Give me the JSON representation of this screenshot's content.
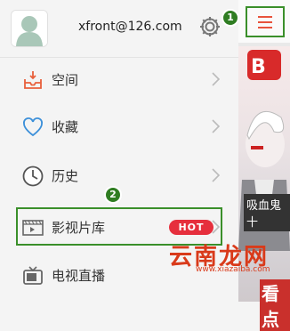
{
  "header": {
    "email": "xfront@126.com"
  },
  "menu": [
    {
      "label": "空间",
      "icon": "space-icon"
    },
    {
      "label": "收藏",
      "icon": "heart-icon"
    },
    {
      "label": "历史",
      "icon": "clock-icon"
    },
    {
      "label": "影视片库",
      "icon": "film-icon",
      "badge": "HOT"
    },
    {
      "label": "电视直播",
      "icon": "tv-icon"
    }
  ],
  "annotations": {
    "step1": "1",
    "step2": "2"
  },
  "right_panel": {
    "banner_caption": "吸血鬼十",
    "banner_tail": "看点"
  },
  "watermark": {
    "main": "云南龙网",
    "sub": "www.xiazaiba.com"
  },
  "colors": {
    "accent_red": "#e62f3d",
    "highlight_green": "#3a8f2a"
  }
}
